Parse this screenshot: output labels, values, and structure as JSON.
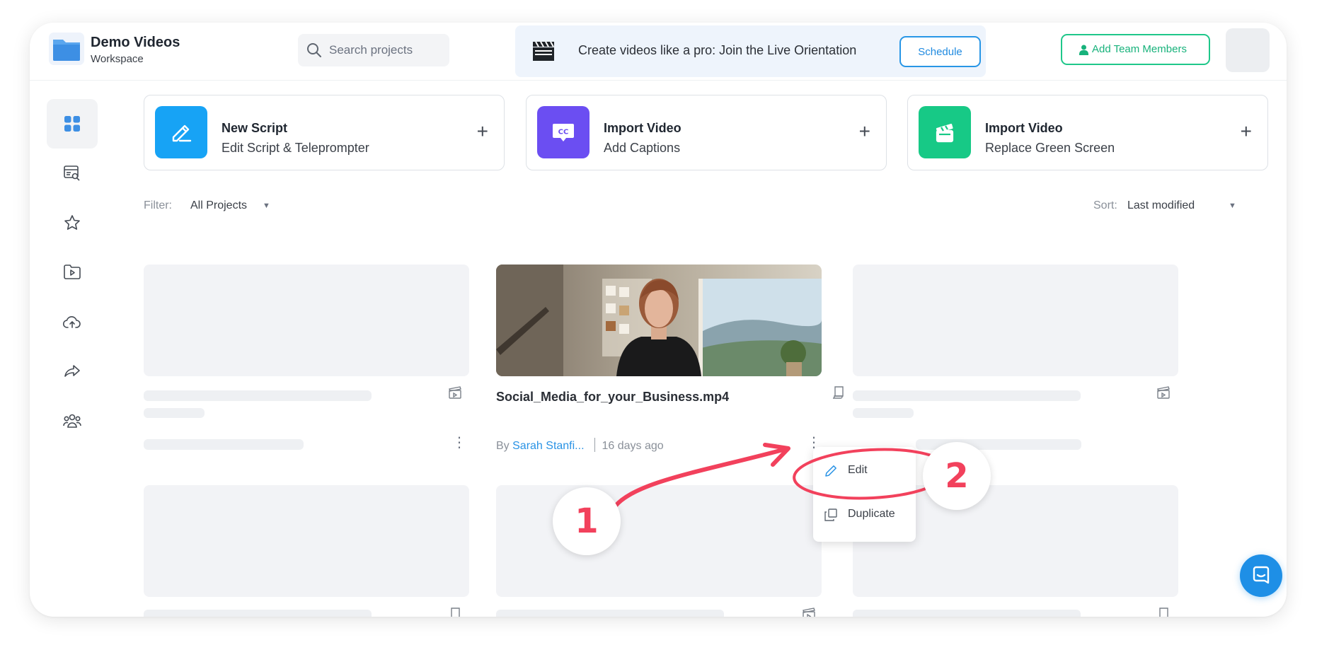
{
  "workspace": {
    "name": "Demo Videos",
    "label": "Workspace"
  },
  "search": {
    "placeholder": "Search projects"
  },
  "banner": {
    "text": "Create videos like a pro: Join the Live Orientation",
    "button": "Schedule"
  },
  "header": {
    "add_team_label": "Add Team Members"
  },
  "sidebar": {
    "items": [
      {
        "icon": "grid-icon",
        "active": true
      },
      {
        "icon": "script-preview-icon"
      },
      {
        "icon": "star-icon"
      },
      {
        "icon": "video-folder-icon"
      },
      {
        "icon": "cloud-upload-icon"
      },
      {
        "icon": "share-icon"
      },
      {
        "icon": "team-icon"
      }
    ]
  },
  "quick_actions": [
    {
      "title": "New Script",
      "subtitle": "Edit Script & Teleprompter",
      "icon": "pencil-icon",
      "color": "#17a3f5"
    },
    {
      "title": "Import Video",
      "subtitle": "Add Captions",
      "icon": "captions-icon",
      "color": "#6b4ef2"
    },
    {
      "title": "Import Video",
      "subtitle": "Replace Green Screen",
      "icon": "clapperboard-icon",
      "color": "#17c986"
    }
  ],
  "filter": {
    "label": "Filter:",
    "value": "All Projects"
  },
  "sort": {
    "label": "Sort:",
    "value": "Last modified"
  },
  "project": {
    "title": "Social_Media_for_your_Business.mp4",
    "by": "By",
    "author": "Sarah Stanfi...",
    "age": "16 days ago"
  },
  "context_menu": {
    "items": [
      "Edit",
      "Duplicate"
    ]
  },
  "annotations": {
    "step1": "1",
    "step2": "2",
    "color": "#f2415c"
  }
}
